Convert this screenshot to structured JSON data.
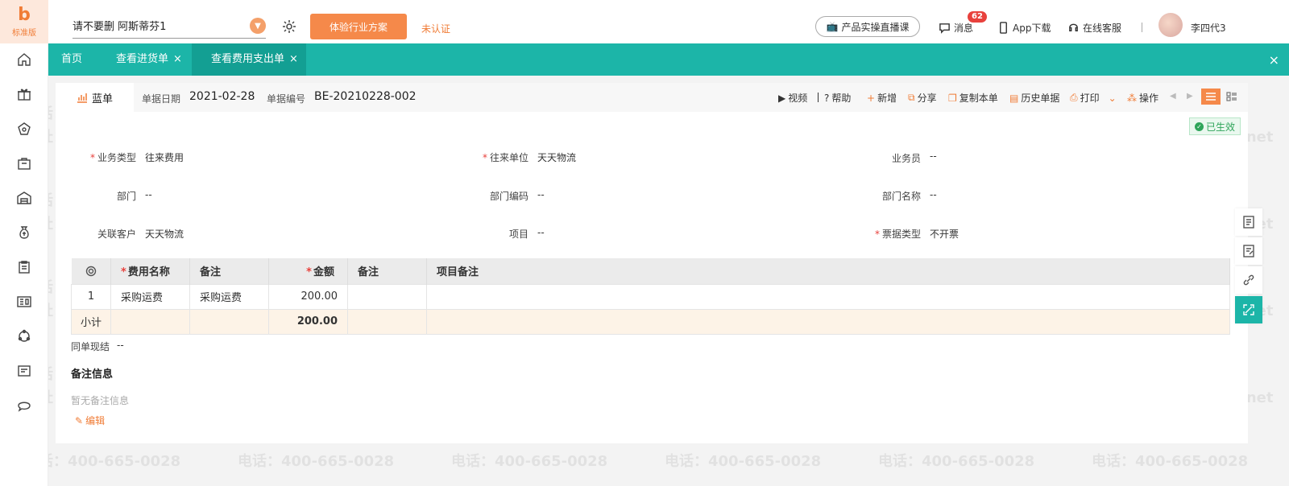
{
  "brand": {
    "edition": "标准版",
    "accent": "#f07c36",
    "teal": "#1cb5a8"
  },
  "topbar": {
    "company": "请不要删 阿斯蒂芬1",
    "industry_button": "体验行业方案",
    "cert_status": "未认证",
    "live_button": "产品实操直播课",
    "messages": "消息",
    "message_count": "62",
    "app_download": "App下载",
    "support": "在线客服",
    "username": "李四代3"
  },
  "tabs": [
    {
      "label": "首页"
    },
    {
      "label": "查看进货单",
      "close": "×"
    },
    {
      "label": "查看费用支出单",
      "close": "×"
    }
  ],
  "tabbar_close": "×",
  "header": {
    "bill_tab": "蓝单",
    "date_label": "单据日期",
    "date_value": "2021-02-28",
    "code_label": "单据编号",
    "code_value": "BE-20210228-002"
  },
  "toolbar": {
    "video": "视频",
    "help": "帮助",
    "add": "新增",
    "share": "分享",
    "copy": "复制本单",
    "history": "历史单据",
    "print": "打印",
    "ops": "操作"
  },
  "status": "已生效",
  "fields": {
    "biz_type": {
      "label": "业务类型",
      "value": "往来费用"
    },
    "partner": {
      "label": "往来单位",
      "value": "天天物流"
    },
    "salesman": {
      "label": "业务员",
      "value": "--"
    },
    "dept": {
      "label": "部门",
      "value": "--"
    },
    "dept_code": {
      "label": "部门编码",
      "value": "--"
    },
    "dept_name": {
      "label": "部门名称",
      "value": "--"
    },
    "customer": {
      "label": "关联客户",
      "value": "天天物流"
    },
    "project": {
      "label": "项目",
      "value": "--"
    },
    "invoice_type": {
      "label": "票据类型",
      "value": "不开票"
    }
  },
  "table": {
    "headers": {
      "name": "费用名称",
      "note": "备注",
      "amount": "金额",
      "note2": "备注",
      "project_note": "项目备注"
    },
    "rows": [
      {
        "index": "1",
        "name": "采购运费",
        "note": "采购运费",
        "amount": "200.00",
        "note2": "",
        "project_note": ""
      }
    ],
    "subtotal": {
      "label": "小计",
      "amount": "200.00"
    }
  },
  "cash": {
    "label": "同单现结",
    "value": "--"
  },
  "remark": {
    "title": "备注信息",
    "empty": "暂无备注信息",
    "edit": "编辑"
  },
  "watermark": {
    "phone": "电话：400-665-0028",
    "site": "网址：www.chanjet.net"
  }
}
